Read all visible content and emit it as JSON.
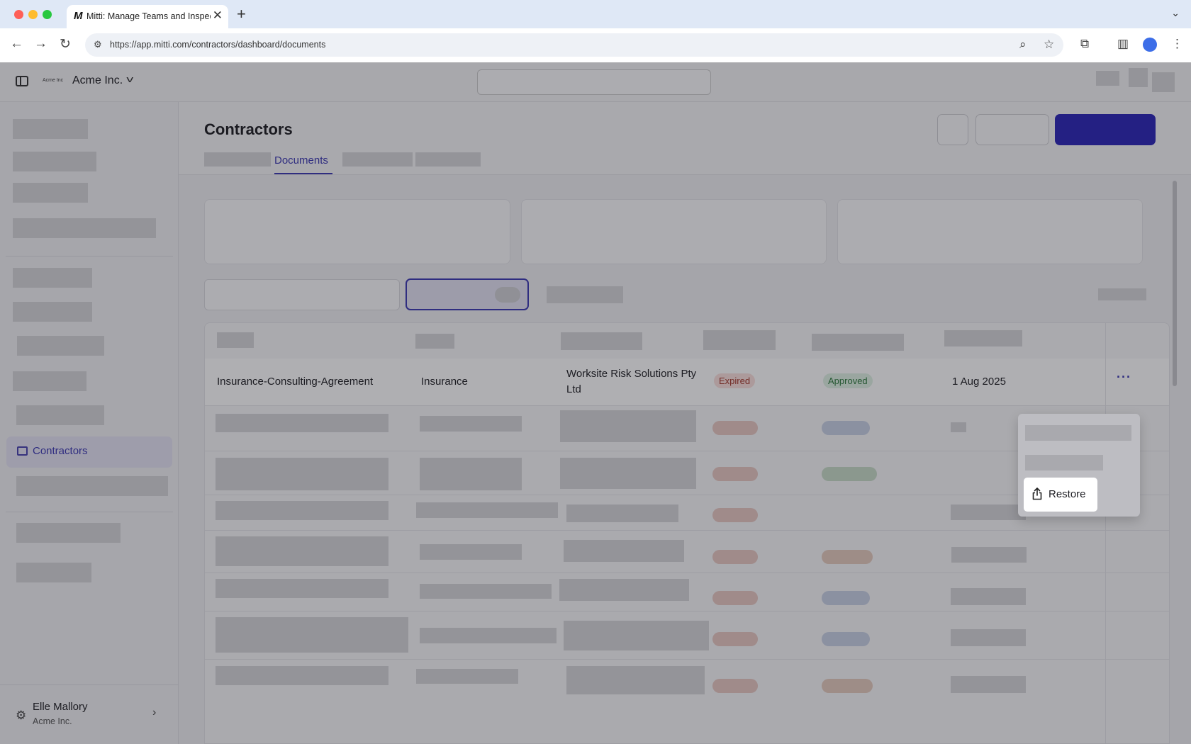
{
  "browser": {
    "tab_title": "Mitti: Manage Teams and Inspection",
    "tab_icon": "M",
    "url": "https://app.mitti.com/contractors/dashboard/documents"
  },
  "app": {
    "org_logo_text": "Acme Inc",
    "org_name": "Acme Inc.",
    "accent_color": "#3e3ab3"
  },
  "sidebar": {
    "active_item": "Contractors",
    "user": {
      "name": "Elle Mallory",
      "org": "Acme Inc."
    }
  },
  "page": {
    "title": "Contractors",
    "active_tab": "Documents"
  },
  "table": {
    "visible_row": {
      "document_name": "Insurance-Consulting-Agreement",
      "type": "Insurance",
      "contractor": "Worksite Risk Solutions Pty Ltd",
      "expiry_status": "Expired",
      "review_status": "Approved",
      "date": "1 Aug 2025"
    }
  },
  "menu": {
    "restore_label": "Restore",
    "restore_icon": "share-upload-icon"
  }
}
